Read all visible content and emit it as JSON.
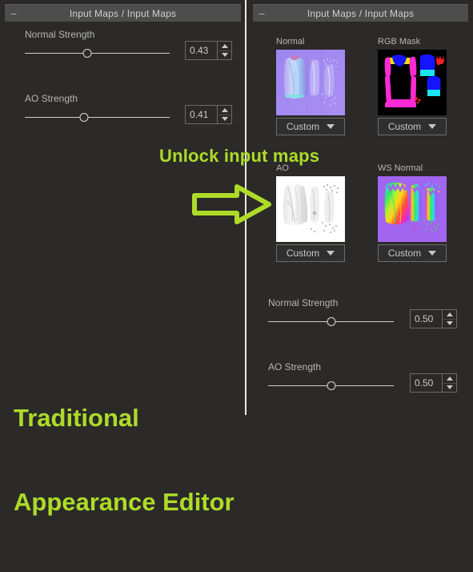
{
  "app": {
    "background_color": "#2b2a29",
    "accent_color": "#aedb28"
  },
  "left_panel": {
    "titlebar": {
      "collapse_icon": "minus-icon",
      "minus_glyph": "–",
      "title": "Input Maps / Input Maps"
    },
    "sliders": [
      {
        "label": "Normal Strength",
        "value": "0.43",
        "fraction": 0.43,
        "min": "0.00",
        "max": "1.00"
      },
      {
        "label": "AO Strength",
        "value": "0.41",
        "fraction": 0.41,
        "min": "0.00",
        "max": "1.00"
      }
    ]
  },
  "right_panel": {
    "titlebar": {
      "collapse_icon": "minus-icon",
      "minus_glyph": "–",
      "title": "Input Maps / Input Maps"
    },
    "maps": [
      {
        "label": "Normal",
        "thumbnail": "normal-map-thumbnail",
        "source": "Custom",
        "caret_icon": "chevron-down-icon"
      },
      {
        "label": "RGB Mask",
        "thumbnail": "rgb-mask-thumbnail",
        "source": "Custom",
        "caret_icon": "chevron-down-icon"
      },
      {
        "label": "AO",
        "thumbnail": "ao-map-thumbnail",
        "source": "Custom",
        "caret_icon": "chevron-down-icon"
      },
      {
        "label": "WS Normal",
        "thumbnail": "ws-normal-map-thumbnail",
        "source": "Custom",
        "caret_icon": "chevron-down-icon"
      }
    ],
    "sliders": [
      {
        "label": "Normal Strength",
        "value": "0.50",
        "fraction": 0.5,
        "min": "0.00",
        "max": "1.00"
      },
      {
        "label": "AO Strength",
        "value": "0.50",
        "fraction": 0.5,
        "min": "0.00",
        "max": "1.00"
      }
    ]
  },
  "annotations": {
    "unlock_text": "Unlock input maps",
    "arrow_icon": "right-arrow-icon",
    "traditional_line1": "Traditional",
    "traditional_line2": "Appearance Editor"
  }
}
